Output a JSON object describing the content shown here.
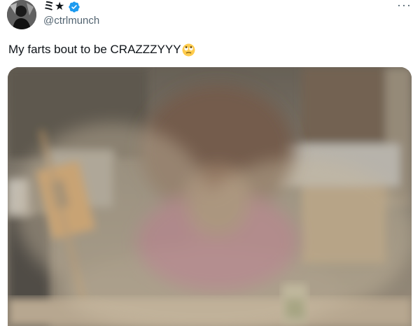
{
  "author": {
    "display_name": "ミ★",
    "handle": "@ctrlmunch",
    "verified": true,
    "avatar_icon": "avatar-photo"
  },
  "more_label": "···",
  "tweet": {
    "text": "My farts bout to be CRAZZZYYY",
    "emoji": "rolling-eyes-emoji"
  },
  "media": {
    "type": "video-still",
    "description_icon": "hazy-kitchen-scene"
  },
  "colors": {
    "verified_blue": "#1d9bf0",
    "handle_gray": "#536471",
    "text": "#0f1419"
  }
}
